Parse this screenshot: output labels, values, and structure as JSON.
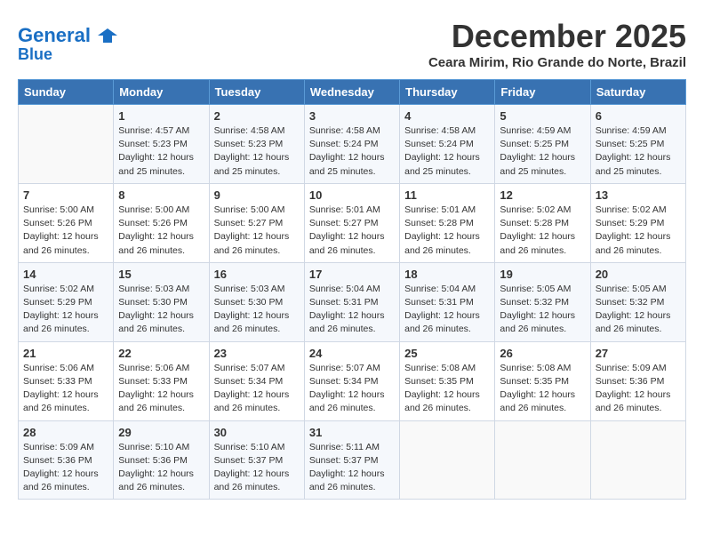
{
  "header": {
    "logo_line1": "General",
    "logo_line2": "Blue",
    "month_title": "December 2025",
    "location": "Ceara Mirim, Rio Grande do Norte, Brazil"
  },
  "days_of_week": [
    "Sunday",
    "Monday",
    "Tuesday",
    "Wednesday",
    "Thursday",
    "Friday",
    "Saturday"
  ],
  "weeks": [
    [
      {
        "day": "",
        "sunrise": "",
        "sunset": "",
        "daylight": ""
      },
      {
        "day": "1",
        "sunrise": "Sunrise: 4:57 AM",
        "sunset": "Sunset: 5:23 PM",
        "daylight": "Daylight: 12 hours and 25 minutes."
      },
      {
        "day": "2",
        "sunrise": "Sunrise: 4:58 AM",
        "sunset": "Sunset: 5:23 PM",
        "daylight": "Daylight: 12 hours and 25 minutes."
      },
      {
        "day": "3",
        "sunrise": "Sunrise: 4:58 AM",
        "sunset": "Sunset: 5:24 PM",
        "daylight": "Daylight: 12 hours and 25 minutes."
      },
      {
        "day": "4",
        "sunrise": "Sunrise: 4:58 AM",
        "sunset": "Sunset: 5:24 PM",
        "daylight": "Daylight: 12 hours and 25 minutes."
      },
      {
        "day": "5",
        "sunrise": "Sunrise: 4:59 AM",
        "sunset": "Sunset: 5:25 PM",
        "daylight": "Daylight: 12 hours and 25 minutes."
      },
      {
        "day": "6",
        "sunrise": "Sunrise: 4:59 AM",
        "sunset": "Sunset: 5:25 PM",
        "daylight": "Daylight: 12 hours and 25 minutes."
      }
    ],
    [
      {
        "day": "7",
        "sunrise": "Sunrise: 5:00 AM",
        "sunset": "Sunset: 5:26 PM",
        "daylight": "Daylight: 12 hours and 26 minutes."
      },
      {
        "day": "8",
        "sunrise": "Sunrise: 5:00 AM",
        "sunset": "Sunset: 5:26 PM",
        "daylight": "Daylight: 12 hours and 26 minutes."
      },
      {
        "day": "9",
        "sunrise": "Sunrise: 5:00 AM",
        "sunset": "Sunset: 5:27 PM",
        "daylight": "Daylight: 12 hours and 26 minutes."
      },
      {
        "day": "10",
        "sunrise": "Sunrise: 5:01 AM",
        "sunset": "Sunset: 5:27 PM",
        "daylight": "Daylight: 12 hours and 26 minutes."
      },
      {
        "day": "11",
        "sunrise": "Sunrise: 5:01 AM",
        "sunset": "Sunset: 5:28 PM",
        "daylight": "Daylight: 12 hours and 26 minutes."
      },
      {
        "day": "12",
        "sunrise": "Sunrise: 5:02 AM",
        "sunset": "Sunset: 5:28 PM",
        "daylight": "Daylight: 12 hours and 26 minutes."
      },
      {
        "day": "13",
        "sunrise": "Sunrise: 5:02 AM",
        "sunset": "Sunset: 5:29 PM",
        "daylight": "Daylight: 12 hours and 26 minutes."
      }
    ],
    [
      {
        "day": "14",
        "sunrise": "Sunrise: 5:02 AM",
        "sunset": "Sunset: 5:29 PM",
        "daylight": "Daylight: 12 hours and 26 minutes."
      },
      {
        "day": "15",
        "sunrise": "Sunrise: 5:03 AM",
        "sunset": "Sunset: 5:30 PM",
        "daylight": "Daylight: 12 hours and 26 minutes."
      },
      {
        "day": "16",
        "sunrise": "Sunrise: 5:03 AM",
        "sunset": "Sunset: 5:30 PM",
        "daylight": "Daylight: 12 hours and 26 minutes."
      },
      {
        "day": "17",
        "sunrise": "Sunrise: 5:04 AM",
        "sunset": "Sunset: 5:31 PM",
        "daylight": "Daylight: 12 hours and 26 minutes."
      },
      {
        "day": "18",
        "sunrise": "Sunrise: 5:04 AM",
        "sunset": "Sunset: 5:31 PM",
        "daylight": "Daylight: 12 hours and 26 minutes."
      },
      {
        "day": "19",
        "sunrise": "Sunrise: 5:05 AM",
        "sunset": "Sunset: 5:32 PM",
        "daylight": "Daylight: 12 hours and 26 minutes."
      },
      {
        "day": "20",
        "sunrise": "Sunrise: 5:05 AM",
        "sunset": "Sunset: 5:32 PM",
        "daylight": "Daylight: 12 hours and 26 minutes."
      }
    ],
    [
      {
        "day": "21",
        "sunrise": "Sunrise: 5:06 AM",
        "sunset": "Sunset: 5:33 PM",
        "daylight": "Daylight: 12 hours and 26 minutes."
      },
      {
        "day": "22",
        "sunrise": "Sunrise: 5:06 AM",
        "sunset": "Sunset: 5:33 PM",
        "daylight": "Daylight: 12 hours and 26 minutes."
      },
      {
        "day": "23",
        "sunrise": "Sunrise: 5:07 AM",
        "sunset": "Sunset: 5:34 PM",
        "daylight": "Daylight: 12 hours and 26 minutes."
      },
      {
        "day": "24",
        "sunrise": "Sunrise: 5:07 AM",
        "sunset": "Sunset: 5:34 PM",
        "daylight": "Daylight: 12 hours and 26 minutes."
      },
      {
        "day": "25",
        "sunrise": "Sunrise: 5:08 AM",
        "sunset": "Sunset: 5:35 PM",
        "daylight": "Daylight: 12 hours and 26 minutes."
      },
      {
        "day": "26",
        "sunrise": "Sunrise: 5:08 AM",
        "sunset": "Sunset: 5:35 PM",
        "daylight": "Daylight: 12 hours and 26 minutes."
      },
      {
        "day": "27",
        "sunrise": "Sunrise: 5:09 AM",
        "sunset": "Sunset: 5:36 PM",
        "daylight": "Daylight: 12 hours and 26 minutes."
      }
    ],
    [
      {
        "day": "28",
        "sunrise": "Sunrise: 5:09 AM",
        "sunset": "Sunset: 5:36 PM",
        "daylight": "Daylight: 12 hours and 26 minutes."
      },
      {
        "day": "29",
        "sunrise": "Sunrise: 5:10 AM",
        "sunset": "Sunset: 5:36 PM",
        "daylight": "Daylight: 12 hours and 26 minutes."
      },
      {
        "day": "30",
        "sunrise": "Sunrise: 5:10 AM",
        "sunset": "Sunset: 5:37 PM",
        "daylight": "Daylight: 12 hours and 26 minutes."
      },
      {
        "day": "31",
        "sunrise": "Sunrise: 5:11 AM",
        "sunset": "Sunset: 5:37 PM",
        "daylight": "Daylight: 12 hours and 26 minutes."
      },
      {
        "day": "",
        "sunrise": "",
        "sunset": "",
        "daylight": ""
      },
      {
        "day": "",
        "sunrise": "",
        "sunset": "",
        "daylight": ""
      },
      {
        "day": "",
        "sunrise": "",
        "sunset": "",
        "daylight": ""
      }
    ]
  ]
}
